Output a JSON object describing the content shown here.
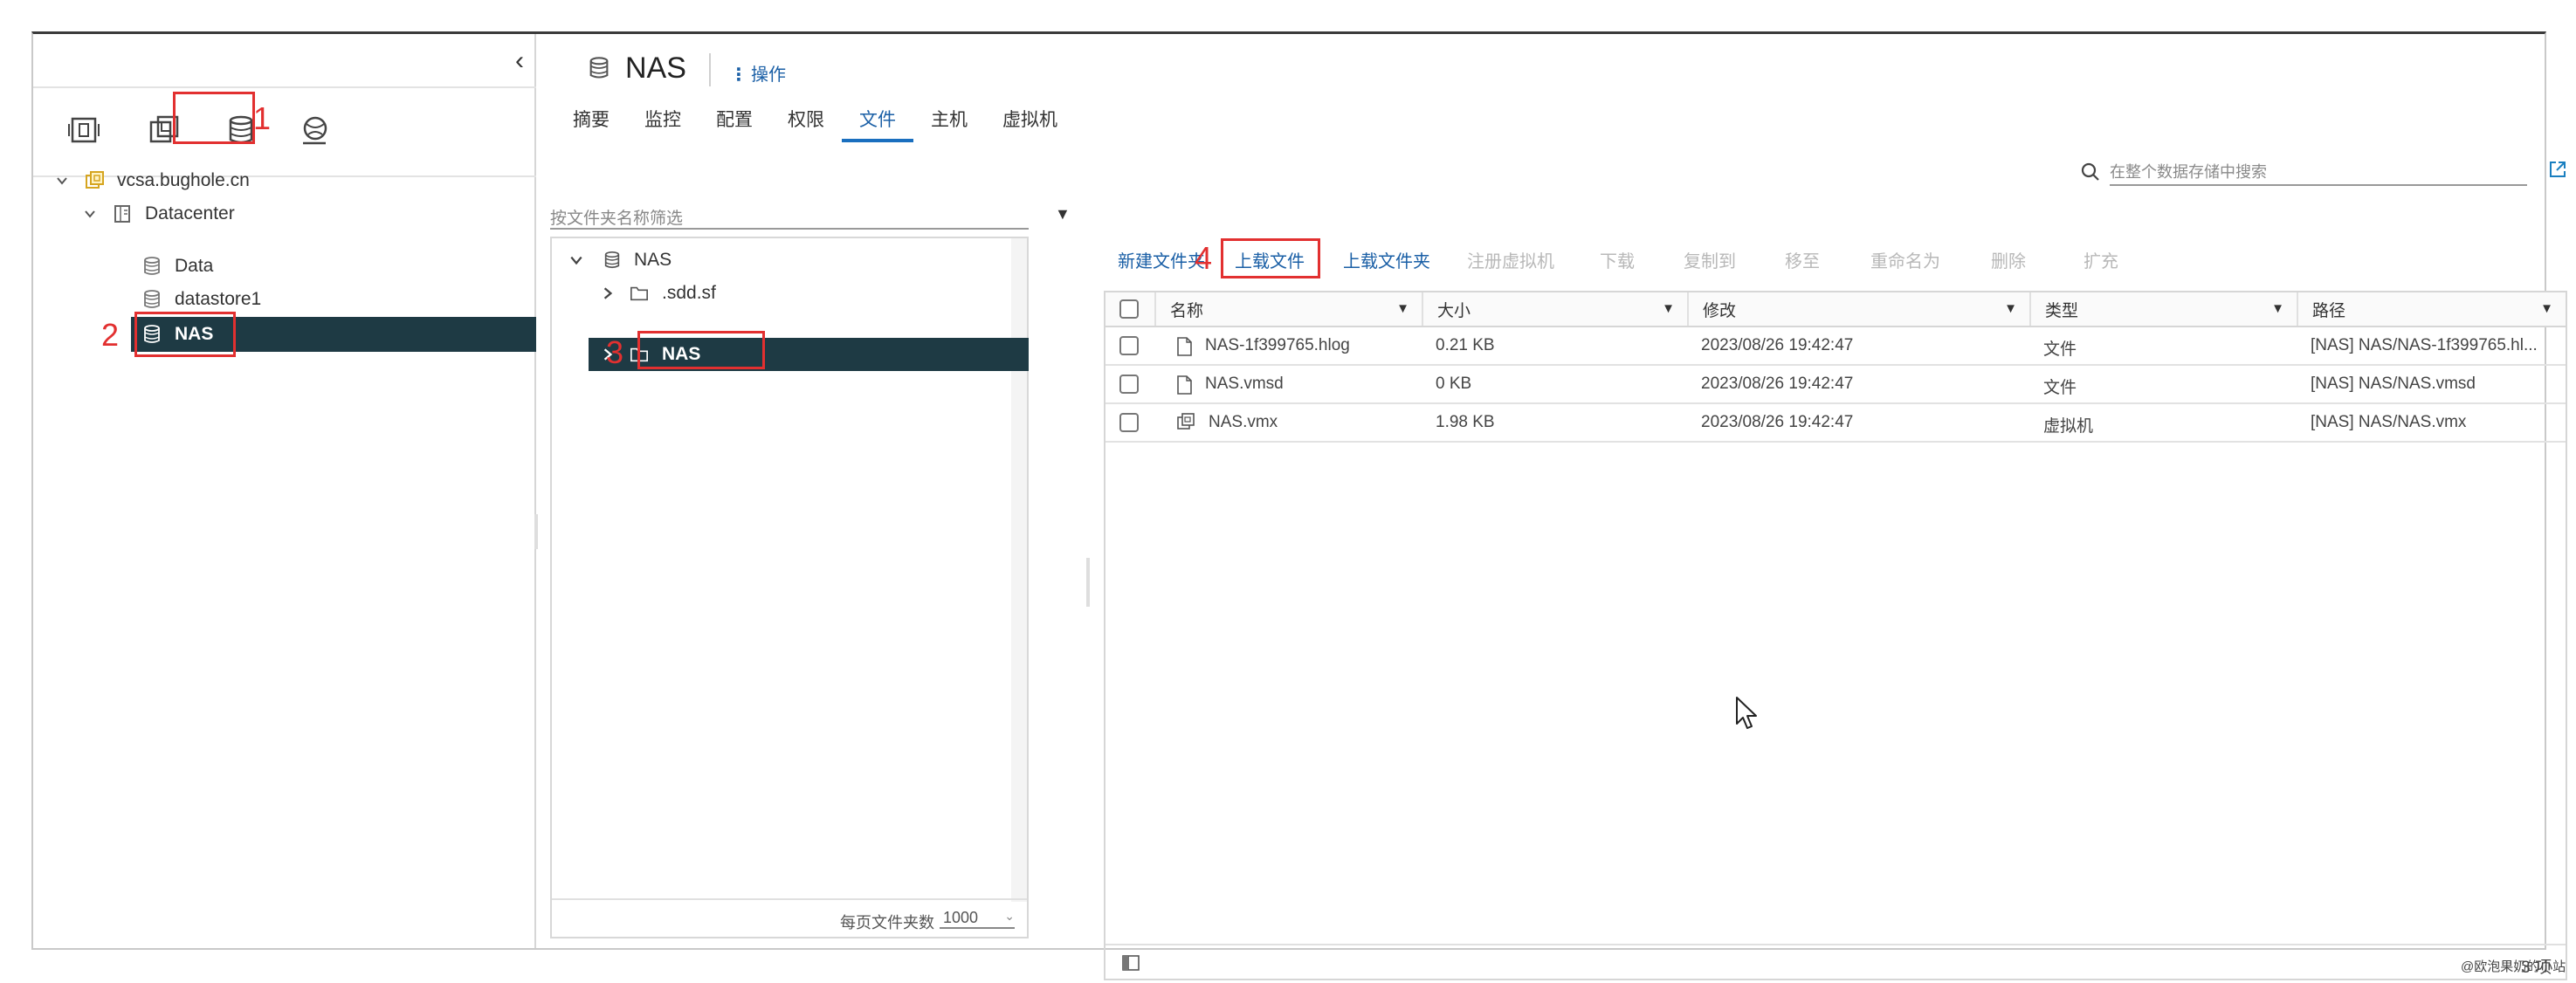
{
  "navigator": {
    "tabs": [
      "hosts-and-clusters-icon",
      "vms-and-templates-icon",
      "storage-icon",
      "networking-icon"
    ],
    "tree": [
      {
        "label": "vcsa.bughole.cn",
        "type": "vcenter"
      },
      {
        "label": "Datacenter",
        "type": "datacenter"
      },
      {
        "label": "Data",
        "type": "datastore"
      },
      {
        "label": "datastore1",
        "type": "datastore"
      },
      {
        "label": "NAS",
        "type": "datastore",
        "selected": true
      }
    ]
  },
  "header": {
    "title": "NAS",
    "actions_label": "操作"
  },
  "tabs": [
    {
      "label": "摘要"
    },
    {
      "label": "监控"
    },
    {
      "label": "配置"
    },
    {
      "label": "权限"
    },
    {
      "label": "文件",
      "active": true
    },
    {
      "label": "主机"
    },
    {
      "label": "虚拟机"
    }
  ],
  "search": {
    "placeholder": "在整个数据存储中搜索"
  },
  "folder_tree": {
    "filter_placeholder": "按文件夹名称筛选",
    "items": [
      {
        "label": "NAS",
        "level": 0,
        "expanded": true
      },
      {
        "label": ".sdd.sf",
        "level": 1
      },
      {
        "label": "NAS",
        "level": 1,
        "selected": true
      }
    ],
    "footer_label": "每页文件夹数",
    "footer_value": "1000"
  },
  "toolbar": {
    "new_folder": "新建文件夹",
    "upload_file": "上载文件",
    "upload_folder": "上载文件夹",
    "register_vm": "注册虚拟机",
    "download": "下载",
    "copy_to": "复制到",
    "move_to": "移至",
    "rename": "重命名为",
    "delete": "删除",
    "inflate": "扩充"
  },
  "grid": {
    "columns": {
      "name": "名称",
      "size": "大小",
      "modified": "修改",
      "type": "类型",
      "path": "路径"
    },
    "rows": [
      {
        "name": "NAS-1f399765.hlog",
        "size": "0.21 KB",
        "modified": "2023/08/26 19:42:47",
        "type": "文件",
        "path": "[NAS] NAS/NAS-1f399765.hl...",
        "icon": "file-icon"
      },
      {
        "name": "NAS.vmsd",
        "size": "0 KB",
        "modified": "2023/08/26 19:42:47",
        "type": "文件",
        "path": "[NAS] NAS/NAS.vmsd",
        "icon": "file-icon"
      },
      {
        "name": "NAS.vmx",
        "size": "1.98 KB",
        "modified": "2023/08/26 19:42:47",
        "type": "虚拟机",
        "path": "[NAS] NAS/NAS.vmx",
        "icon": "vm-icon"
      }
    ],
    "count": "3 项"
  },
  "annotations": [
    "1",
    "2",
    "3",
    "4"
  ],
  "watermark": "@欧泡果奶的小站",
  "colors": {
    "selected_row": "#1e3a44",
    "link": "#1a5fa6",
    "annotation": "#e23030"
  }
}
